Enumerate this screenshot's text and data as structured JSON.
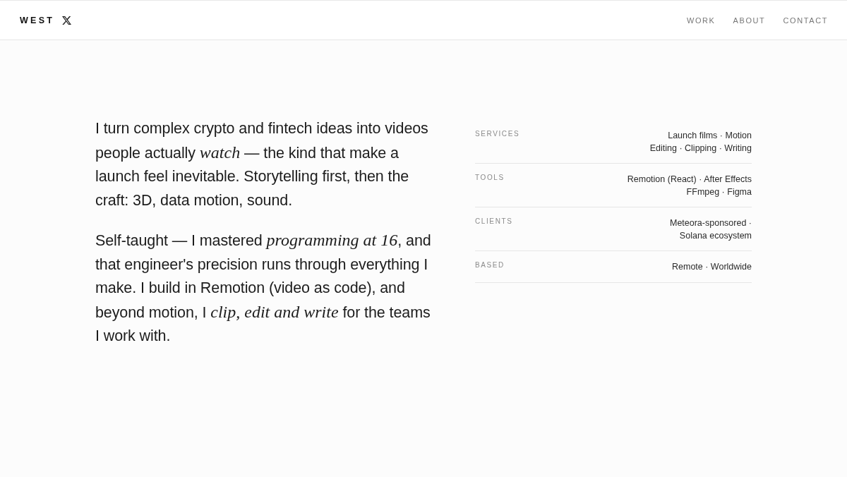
{
  "header": {
    "logo": "WEST",
    "nav": [
      "WORK",
      "ABOUT",
      "CONTACT"
    ]
  },
  "intro": {
    "paragraphs": [
      "I turn complex crypto and fintech ideas into videos people actually *watch* — the kind that make a launch feel inevitable. Storytelling first, then the craft: 3D, data motion, sound.",
      "Self-taught — I mastered *programming at 16*, and that engineer's precision runs through everything I make. I build in Remotion (video as code), and beyond motion, I *clip, edit and write* for the teams I work with."
    ]
  },
  "details": [
    {
      "label": "SERVICES",
      "lines": [
        "Launch films · Motion",
        "Editing · Clipping · Writing"
      ]
    },
    {
      "label": "TOOLS",
      "lines": [
        "Remotion (React) · After Effects",
        "FFmpeg · Figma"
      ]
    },
    {
      "label": "CLIENTS",
      "lines": [
        "Meteora-sponsored ·",
        "Solana ecosystem"
      ]
    },
    {
      "label": "BASED",
      "lines": [
        "Remote · Worldwide"
      ]
    }
  ]
}
